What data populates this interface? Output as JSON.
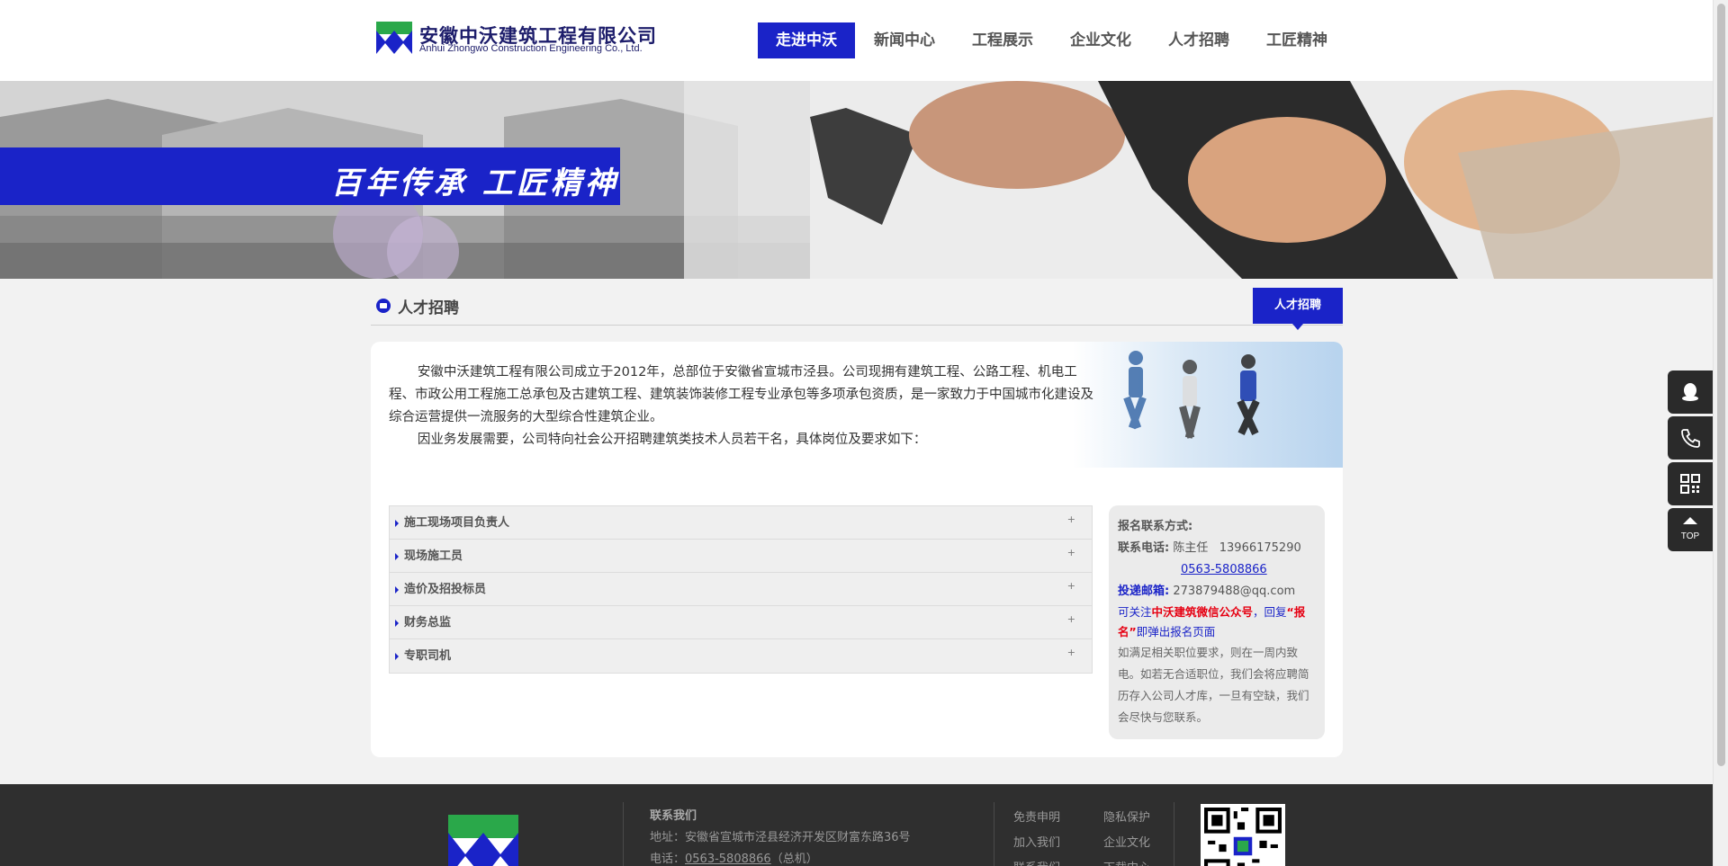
{
  "header": {
    "logo_cn": "安徽中沃建筑工程有限公司",
    "logo_en": "Anhui Zhongwo Construction Engineering Co., Ltd.",
    "nav": [
      {
        "label": "走进中沃",
        "active": true
      },
      {
        "label": "新闻中心",
        "active": false
      },
      {
        "label": "工程展示",
        "active": false
      },
      {
        "label": "企业文化",
        "active": false
      },
      {
        "label": "人才招聘",
        "active": false
      },
      {
        "label": "工匠精神",
        "active": false
      }
    ]
  },
  "banner": {
    "slogan": "百年传承 工匠精神"
  },
  "section": {
    "title": "人才招聘",
    "tag": "人才招聘"
  },
  "intro": {
    "p1": "安徽中沃建筑工程有限公司成立于2012年，总部位于安徽省宣城市泾县。公司现拥有建筑工程、公路工程、机电工程、市政公用工程施工总承包及古建筑工程、建筑装饰装修工程专业承包等多项承包资质，是一家致力于中国城市化建设及综合运营提供一流服务的大型综合性建筑企业。",
    "p2": "因业务发展需要，公司特向社会公开招聘建筑类技术人员若干名，具体岗位及要求如下："
  },
  "jobs": [
    {
      "title": "施工现场项目负责人",
      "toggle": "+"
    },
    {
      "title": "现场施工员",
      "toggle": "+"
    },
    {
      "title": "造价及招投标员",
      "toggle": "+"
    },
    {
      "title": "财务总监",
      "toggle": "+"
    },
    {
      "title": "专职司机",
      "toggle": "+"
    }
  ],
  "contact": {
    "heading": "报名联系方式:",
    "phone_label": "联系电话:",
    "phone_person": "陈主任",
    "phone_mobile": "13966175290",
    "phone_landline": "0563-5808866",
    "email_label": "投递邮箱:",
    "email": "273879488@qq.com",
    "wechat_pre": "可关注",
    "wechat_name": "中沃建筑微信公众号",
    "wechat_mid": "，回复",
    "wechat_key": "“报名”",
    "wechat_post": "即弹出报名页面",
    "note": "如满足相关职位要求，则在一周内致电。如若无合适职位，我们会将应聘简历存入公司人才库，一旦有空缺，我们会尽快与您联系。"
  },
  "sidebar": {
    "buttons": [
      {
        "icon": "qq-icon"
      },
      {
        "icon": "phone-icon"
      },
      {
        "icon": "qrcode-icon"
      },
      {
        "icon": "arrow-up-icon",
        "label": "TOP"
      }
    ]
  },
  "footer": {
    "contact_title": "联系我们",
    "address": "地址：安徽省宣城市泾县经济开发区财富东路36号",
    "phone_prefix": "电话：",
    "phone": "0563-5808866",
    "phone_suffix": "（总机）",
    "links": [
      "免责申明",
      "隐私保护",
      "加入我们",
      "企业文化",
      "联系我们",
      "下载中心"
    ]
  },
  "colors": {
    "brand_blue": "#1a23c8",
    "footer_bg": "#2f2f2f",
    "accent_red": "#e60012"
  }
}
